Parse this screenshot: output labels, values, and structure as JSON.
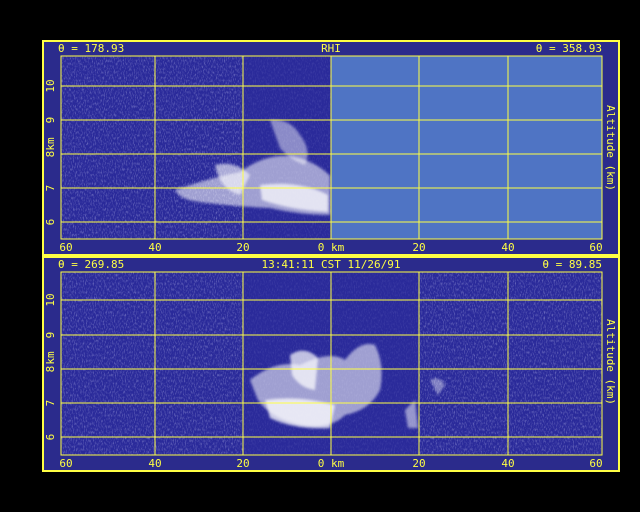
{
  "panel_top": {
    "left_angle": "θ = 178.93",
    "center_label": "RHI",
    "right_angle": "θ = 358.93",
    "y_ticks": [
      "10",
      "9",
      "8",
      "7",
      "6"
    ],
    "y_unit": "km",
    "right_label": "Altitude (km)",
    "x_ticks": [
      "60",
      "40",
      "20",
      "0 km",
      "20",
      "40",
      "60"
    ]
  },
  "panel_bottom": {
    "left_angle": "θ = 269.85",
    "center_label": "13:41:11 CST 11/26/91",
    "right_angle": "θ = 89.85",
    "y_ticks": [
      "10",
      "9",
      "8",
      "7",
      "6"
    ],
    "y_unit": "km",
    "right_label": "Altitude (km)",
    "x_ticks": [
      "60",
      "40",
      "20",
      "0 km",
      "20",
      "40",
      "60"
    ]
  },
  "colors": {
    "background": "#000000",
    "frame": "#2b2b8c",
    "plot": "#2a2a9a",
    "grid": "#ffff44",
    "no_data": "#4f74c4",
    "echo": "#ffffff"
  }
}
